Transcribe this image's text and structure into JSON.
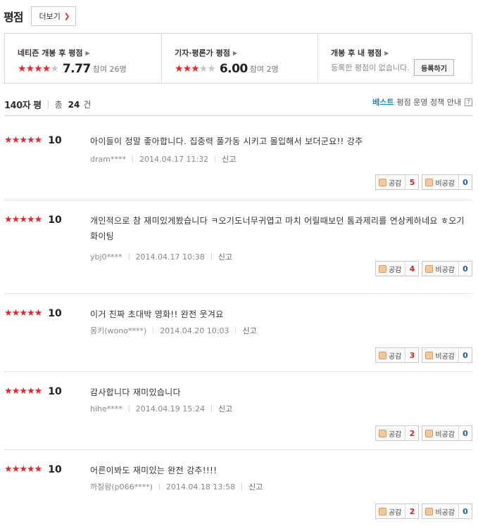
{
  "header": {
    "title": "평점",
    "more_label": "더보기"
  },
  "scores": [
    {
      "label": "네티즌 개봉 후 평점",
      "stars_filled": 4,
      "stars_total": 5,
      "value": "7.77",
      "participants": "참여 26명"
    },
    {
      "label": "기자·평론가 평점",
      "stars_filled": 3,
      "stars_total": 5,
      "value": "6.00",
      "participants": "참여 2명"
    },
    {
      "label": "개봉 후 내 평점",
      "empty_text": "등록한 평점이 없습니다.",
      "register_label": "등록하기"
    }
  ],
  "reviews_bar": {
    "title": "140자 평",
    "total_label": "총",
    "total_count": "24",
    "total_unit": "건",
    "best_label": "베스트",
    "policy_label": "평점 운영 정책 안내",
    "help_label": "?"
  },
  "vote_labels": {
    "up": "공감",
    "down": "비공감"
  },
  "report_label": "신고",
  "reviews": [
    {
      "stars": 5,
      "score": "10",
      "text": "아이들이 정말 좋아합니다. 집중력 풀가동 시키고 몰입해서 보더군요!! 강추",
      "user": "dram****",
      "date": "2014.04.17 11:32",
      "up": "5",
      "down": "0"
    },
    {
      "stars": 5,
      "score": "10",
      "text": "개인적으로 참 재미있게봤습니다 ㅋ오기도너무귀엽고 마치 어릴때보던 톰과제리를 연상케하네요 ㅎ오기화이팅",
      "user": "ybj0****",
      "date": "2014.04.17 10:38",
      "up": "4",
      "down": "0"
    },
    {
      "stars": 5,
      "score": "10",
      "text": "이거 진짜 초대박 영화!! 완전 웃겨요",
      "user": "몽키(wono****)",
      "date": "2014.04.20 10:03",
      "up": "3",
      "down": "0"
    },
    {
      "stars": 5,
      "score": "10",
      "text": "감사합니다 재미있습니다",
      "user": "hihe****",
      "date": "2014.04.19 15:24",
      "up": "2",
      "down": "0"
    },
    {
      "stars": 5,
      "score": "10",
      "text": "어른이봐도 재미있는 완전 강추!!!!",
      "user": "까칠왕(p066****)",
      "date": "2014.04.18 13:58",
      "up": "2",
      "down": "0"
    }
  ],
  "colors": {
    "star_on": "#e6262e",
    "star_off": "#c6c6c6",
    "best": "#1f87c8",
    "up_count": "#e02020",
    "down_count": "#1f5fa8"
  }
}
